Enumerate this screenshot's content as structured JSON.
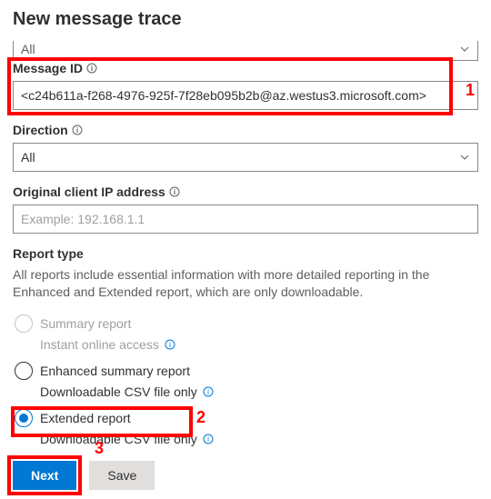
{
  "title": "New message trace",
  "top_select_value": "All",
  "message_id": {
    "label": "Message ID",
    "value": "<c24b611a-f268-4976-925f-7f28eb095b2b@az.westus3.microsoft.com>"
  },
  "direction": {
    "label": "Direction",
    "value": "All"
  },
  "client_ip": {
    "label": "Original client IP address",
    "placeholder": "Example: 192.168.1.1",
    "value": ""
  },
  "report_type": {
    "label": "Report type",
    "desc": "All reports include essential information with more detailed reporting in the Enhanced and Extended report, which are only downloadable.",
    "options": [
      {
        "label": "Summary report",
        "sub": "Instant online access",
        "state": "disabled"
      },
      {
        "label": "Enhanced summary report",
        "sub": "Downloadable CSV file only",
        "state": "unselected"
      },
      {
        "label": "Extended report",
        "sub": "Downloadable CSV file only",
        "state": "selected"
      }
    ]
  },
  "buttons": {
    "next": "Next",
    "save": "Save"
  },
  "annotations": {
    "a1": "1",
    "a2": "2",
    "a3": "3"
  }
}
